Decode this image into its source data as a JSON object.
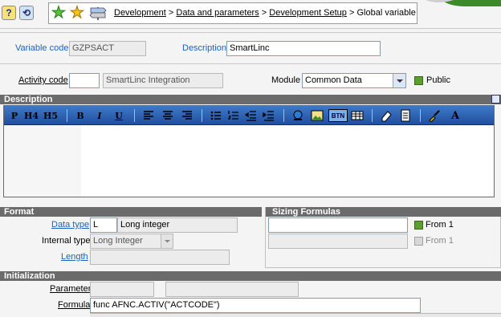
{
  "toolbar": {
    "breadcrumb": [
      "Development",
      "Data and parameters",
      "Development Setup"
    ],
    "breadcrumb_current": "Global variable",
    "separator": ">"
  },
  "header": {
    "variable_code_label": "Variable code",
    "variable_code_value": "GZPSACT",
    "description_label": "Description",
    "description_value": "SmartLinc",
    "activity_code_label": "Activity code",
    "activity_code_value": "",
    "activity_desc_value": "SmartLinc Integration",
    "module_label": "Module",
    "module_value": "Common Data",
    "public_label": "Public"
  },
  "description_section": {
    "title": "Description",
    "toolbar_buttons": [
      "P",
      "H4",
      "H5",
      "B",
      "I",
      "U",
      "BTN"
    ]
  },
  "format_section": {
    "title": "Format",
    "data_type_label": "Data type",
    "data_type_code": "L",
    "data_type_desc": "Long integer",
    "internal_type_label": "Internal type",
    "internal_type_value": "Long Integer",
    "length_label": "Length",
    "length_value": ""
  },
  "sizing_section": {
    "title": "Sizing Formulas",
    "from1_label": "From 1",
    "from1b_label": "From 1"
  },
  "init_section": {
    "title": "Initialization",
    "parameter_label": "Parameter",
    "formula_label": "Formula",
    "formula_value": "func AFNC.ACTIV(\"ACTCODE\")"
  },
  "colors": {
    "link_blue": "#1a62c0",
    "section_header": "#6b6b6b",
    "editor_toolbar": "#2a5fb0",
    "checkbox_green": "#5aa02c"
  }
}
